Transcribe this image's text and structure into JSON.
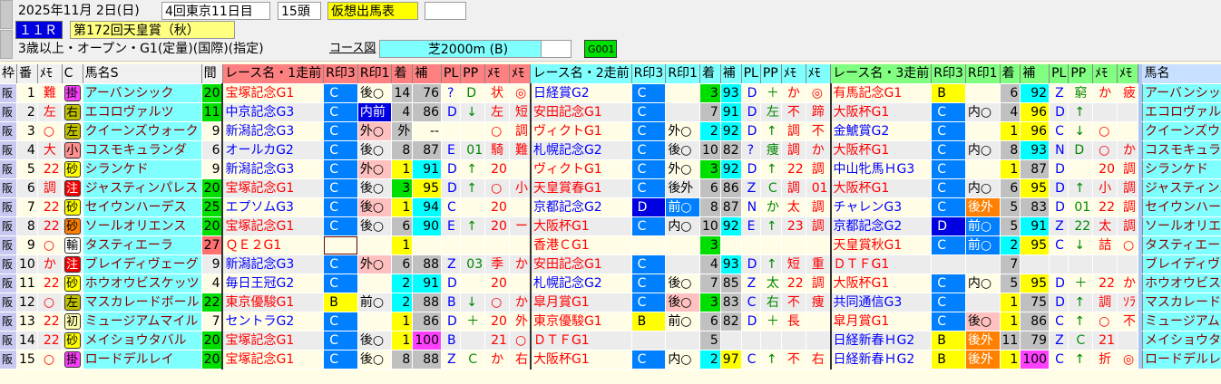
{
  "header": {
    "date": "2025年11月 2日(日)",
    "meeting": "4回東京11日目",
    "runners": "15頭",
    "mode": "仮想出馬表",
    "race_no": "１１Ｒ",
    "race_title": "第172回天皇賞（秋）",
    "conditions": "3歳以上・オープン・G1(定量)(国際)(指定)",
    "course_link": "コース図",
    "course": "芝2000m (B)",
    "code": "G001"
  },
  "columns": {
    "waku": "枠",
    "ban": "番",
    "memo": "ﾒﾓ",
    "c": "C",
    "name": "馬名S",
    "interval": "間",
    "race_names": [
      "レース名・1走前",
      "レース名・2走前",
      "レース名・3走前"
    ],
    "r3": "R印3",
    "r1": "R印1",
    "rank": "着",
    "ho": "補",
    "pl": "PL",
    "pp": "PP",
    "m1": "ﾒﾓ",
    "m2": "ﾒﾓ",
    "name2": "馬名"
  },
  "colors": {
    "c_blue": "#0080ff",
    "d_blue": "#0000e0",
    "b_yellow": "#ffff00",
    "rank1": "#ffff00",
    "rank2": "#00ffff",
    "rank3": "#00e000",
    "pink": "#ffc0c0",
    "orange": "#ff8000",
    "magenta": "#ff40ff"
  },
  "horses": [
    {
      "waku": "阪",
      "num": "1",
      "memo": "難",
      "cmark": "掛",
      "cbg": "#ff40ff",
      "name": "アーバンシック",
      "interval": "20",
      "ibg": "#00e000",
      "races": [
        [
          "宝塚記念G1",
          "C",
          "後○",
          "",
          "14",
          "76",
          "?",
          "D",
          "状",
          "◎"
        ],
        [
          "日経賞G2",
          "C",
          "",
          "",
          "3",
          "93",
          "D",
          "＋",
          "か",
          "◎"
        ],
        [
          "有馬記念G1",
          "B",
          "",
          "",
          "6",
          "92",
          "Z",
          "窮",
          "か",
          "疲"
        ]
      ]
    },
    {
      "waku": "阪",
      "num": "2",
      "memo": "左",
      "cmark": "右",
      "cbg": "#c0c000",
      "name": "エコロヴァルツ",
      "interval": "11",
      "ibg": "#00e000",
      "races": [
        [
          "中京記念G3",
          "C",
          "内前",
          "dark",
          "4",
          "86",
          "D",
          "↓",
          "左",
          "短"
        ],
        [
          "安田記念G1",
          "C",
          "",
          "",
          "7",
          "91",
          "D",
          "左",
          "不",
          "蹄"
        ],
        [
          "大阪杯G1",
          "C",
          "内○",
          "",
          "4",
          "96",
          "D",
          "↑",
          "",
          ""
        ]
      ]
    },
    {
      "waku": "阪",
      "num": "3",
      "memo": "○",
      "cmark": "左",
      "cbg": "#c0c000",
      "name": "クイーンズウォーク",
      "interval": "9",
      "ibg": "",
      "races": [
        [
          "新潟記念G3",
          "C",
          "外○",
          "pink",
          "外",
          "--",
          "",
          "",
          "○",
          "調"
        ],
        [
          "ヴィクトG1",
          "C",
          "外○",
          "",
          "2",
          "92",
          "D",
          "↑",
          "調",
          "不"
        ],
        [
          "金鯱賞G2",
          "C",
          "",
          "",
          "1",
          "96",
          "C",
          "↓",
          "○",
          ""
        ]
      ]
    },
    {
      "waku": "阪",
      "num": "4",
      "memo": "大",
      "cmark": "小",
      "cbg": "#ff9090",
      "name": "コスモキュランダ",
      "interval": "6",
      "ibg": "",
      "races": [
        [
          "オールカG2",
          "C",
          "後○",
          "",
          "8",
          "87",
          "E",
          "01",
          "騎",
          "難"
        ],
        [
          "札幌記念G2",
          "C",
          "後○",
          "",
          "10",
          "82",
          "?",
          "痩",
          "調",
          "か"
        ],
        [
          "大阪杯G1",
          "C",
          "内○",
          "",
          "8",
          "93",
          "N",
          "D",
          "○",
          "か"
        ]
      ]
    },
    {
      "waku": "阪",
      "num": "5",
      "memo": "22",
      "cmark": "砂",
      "cbg": "#ffff00",
      "name": "シランケド",
      "interval": "9",
      "ibg": "",
      "races": [
        [
          "新潟記念G3",
          "C",
          "外○",
          "pink",
          "1",
          "91",
          "D",
          "↑",
          "20",
          ""
        ],
        [
          "ヴィクトG1",
          "C",
          "外○",
          "",
          "3",
          "92",
          "D",
          "↑",
          "22",
          "調"
        ],
        [
          "中山牝馬ＨG3",
          "C",
          "",
          "",
          "1",
          "87",
          "D",
          "",
          "20",
          "調"
        ]
      ]
    },
    {
      "waku": "阪",
      "num": "6",
      "memo": "調",
      "cmark": "注",
      "cbg": "#f00000",
      "name": "ジャスティンパレス",
      "interval": "20",
      "ibg": "#00e000",
      "races": [
        [
          "宝塚記念G1",
          "C",
          "後○",
          "",
          "3",
          "95",
          "D",
          "↑",
          "○",
          "小"
        ],
        [
          "天皇賞春G1",
          "C",
          "後外",
          "",
          "6",
          "86",
          "Z",
          "Ｃ",
          "調",
          "01"
        ],
        [
          "大阪杯G1",
          "C",
          "内○",
          "",
          "6",
          "95",
          "D",
          "↑",
          "小",
          "調"
        ]
      ]
    },
    {
      "waku": "阪",
      "num": "7",
      "memo": "22",
      "cmark": "砂",
      "cbg": "#ffff00",
      "name": "セイウンハーデス",
      "interval": "25",
      "ibg": "#00e000",
      "races": [
        [
          "エプソムG3",
          "C",
          "後○",
          "pink",
          "1",
          "94",
          "C",
          "",
          "20",
          ""
        ],
        [
          "京都記念G2",
          "D",
          "前○",
          "blue",
          "8",
          "87",
          "N",
          "か",
          "太",
          "調"
        ],
        [
          "チャレンG3",
          "C",
          "後外",
          "orange",
          "5",
          "83",
          "D",
          "01",
          "22",
          "調"
        ]
      ]
    },
    {
      "waku": "阪",
      "num": "8",
      "memo": "22",
      "cmark": "砂",
      "cbg": "#ff8000",
      "name": "ソールオリエンス",
      "interval": "20",
      "ibg": "#00e000",
      "races": [
        [
          "宝塚記念G1",
          "C",
          "後○",
          "",
          "6",
          "90",
          "E",
          "↑",
          "20",
          "ー"
        ],
        [
          "大阪杯G1",
          "C",
          "内○",
          "",
          "10",
          "92",
          "E",
          "↑",
          "23",
          "調"
        ],
        [
          "京都記念G2",
          "D",
          "前○",
          "blue",
          "5",
          "91",
          "Z",
          "22",
          "太",
          "調"
        ]
      ]
    },
    {
      "waku": "阪",
      "num": "9",
      "memo": "○",
      "cmark": "輸",
      "cbg": "#ffffff",
      "name": "タスティエーラ",
      "interval": "27",
      "ibg": "#ff7070",
      "races": [
        [
          "ＱＥ２G1",
          "box",
          "",
          "",
          "1",
          "",
          "",
          "",
          "",
          ""
        ],
        [
          "香港ＣG1",
          "",
          "",
          "",
          "3",
          "",
          "",
          "",
          "",
          ""
        ],
        [
          "天皇賞秋G1",
          "C",
          "前○",
          "blue",
          "2",
          "95",
          "C",
          "↓",
          "詰",
          "○"
        ]
      ]
    },
    {
      "waku": "阪",
      "num": "10",
      "memo": "か",
      "cmark": "注",
      "cbg": "#f00000",
      "name": "ブレイディヴェーグ",
      "interval": "9",
      "ibg": "",
      "races": [
        [
          "新潟記念G3",
          "C",
          "外○",
          "pink",
          "6",
          "88",
          "Z",
          "03",
          "季",
          "か"
        ],
        [
          "安田記念G1",
          "C",
          "",
          "",
          "4",
          "93",
          "D",
          "↑",
          "短",
          "重"
        ],
        [
          "ＤＴＦG1",
          "",
          "",
          "",
          "7",
          "",
          "",
          "",
          "",
          ""
        ]
      ]
    },
    {
      "waku": "阪",
      "num": "11",
      "memo": "22",
      "cmark": "砂",
      "cbg": "#ffff00",
      "name": "ホウオウビスケッツ",
      "interval": "4",
      "ibg": "",
      "races": [
        [
          "毎日王冠G2",
          "C",
          "",
          "",
          "2",
          "91",
          "D",
          "",
          "20",
          ""
        ],
        [
          "札幌記念G2",
          "C",
          "後○",
          "",
          "7",
          "85",
          "Z",
          "太",
          "22",
          "調"
        ],
        [
          "大阪杯G1",
          "C",
          "内○",
          "",
          "5",
          "95",
          "D",
          "＋",
          "22",
          "か"
        ]
      ]
    },
    {
      "waku": "阪",
      "num": "12",
      "memo": "○",
      "cmark": "左",
      "cbg": "#c0c000",
      "name": "マスカレードボール",
      "interval": "22",
      "ibg": "#00e000",
      "races": [
        [
          "東京優駿G1",
          "B",
          "前○",
          "",
          "2",
          "88",
          "B",
          "↓",
          "○",
          "か"
        ],
        [
          "皐月賞G1",
          "C",
          "後○",
          "pink",
          "3",
          "83",
          "C",
          "右",
          "不",
          "痩"
        ],
        [
          "共同通信G3",
          "C",
          "",
          "",
          "1",
          "75",
          "D",
          "↑",
          "調",
          "ｿﾗ"
        ]
      ]
    },
    {
      "waku": "阪",
      "num": "13",
      "memo": "22",
      "cmark": "初",
      "cbg": "#ffffb0",
      "name": "ミュージアムマイル",
      "interval": "7",
      "ibg": "",
      "races": [
        [
          "セントラG2",
          "C",
          "",
          "",
          "1",
          "86",
          "D",
          "＋",
          "20",
          "外"
        ],
        [
          "東京優駿G1",
          "B",
          "前○",
          "",
          "6",
          "82",
          "D",
          "＋",
          "長",
          ""
        ],
        [
          "皐月賞G1",
          "C",
          "後○",
          "pink",
          "1",
          "86",
          "C",
          "↑",
          "○",
          "不"
        ]
      ]
    },
    {
      "waku": "阪",
      "num": "14",
      "memo": "22",
      "cmark": "砂",
      "cbg": "#ffff00",
      "name": "メイショウタバル",
      "interval": "20",
      "ibg": "#00e000",
      "races": [
        [
          "宝塚記念G1",
          "C",
          "後○",
          "",
          "1",
          "100",
          "B",
          "",
          "21",
          "○"
        ],
        [
          "ＤＴＦG1",
          "",
          "",
          "",
          "5",
          "",
          "",
          "",
          "",
          ""
        ],
        [
          "日経新春ＨG2",
          "B",
          "後外",
          "orange",
          "11",
          "79",
          "Z",
          "Ｃ",
          "21",
          ""
        ]
      ]
    },
    {
      "waku": "阪",
      "num": "15",
      "memo": "○",
      "cmark": "掛",
      "cbg": "#ff40ff",
      "name": "ロードデルレイ",
      "interval": "20",
      "ibg": "#00e000",
      "races": [
        [
          "宝塚記念G1",
          "C",
          "後○",
          "",
          "8",
          "88",
          "Z",
          "Ｃ",
          "か",
          "右"
        ],
        [
          "大阪杯G1",
          "C",
          "内○",
          "",
          "2",
          "97",
          "C",
          "↑",
          "不",
          "右"
        ],
        [
          "日経新春ＨG2",
          "B",
          "後外",
          "orange",
          "1",
          "100",
          "C",
          "↑",
          "折",
          "◎"
        ]
      ]
    }
  ]
}
